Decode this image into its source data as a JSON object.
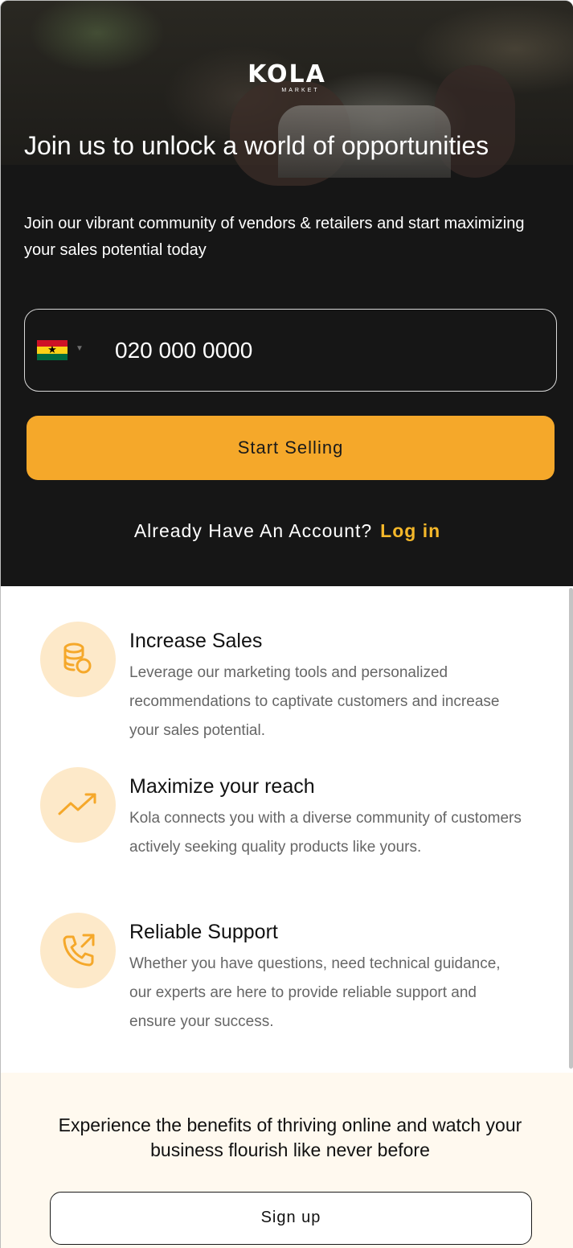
{
  "brand": {
    "logo_word": "KOLA",
    "logo_sub": "MARKET"
  },
  "hero": {
    "title": "Join us to unlock a world of opportunities",
    "subtitle": "Join our vibrant community of vendors & retailers and start maximizing your sales potential today",
    "phone": {
      "country": "Ghana",
      "flag_icon": "ghana-flag-icon",
      "value": "020 000 0000"
    },
    "start_button": "Start Selling",
    "login_prompt": "Already Have An Account?",
    "login_link": "Log in"
  },
  "features": [
    {
      "icon": "coins-icon",
      "title": "Increase Sales",
      "description": "Leverage our marketing tools and personalized recommendations to captivate customers and increase your sales potential."
    },
    {
      "icon": "trending-up-icon",
      "title": "Maximize your reach",
      "description": "Kola connects you with a diverse community of customers actively seeking quality products like yours."
    },
    {
      "icon": "phone-outgoing-icon",
      "title": "Reliable Support",
      "description": "Whether you have questions, need technical guidance, our experts are here to provide reliable support and ensure your success."
    }
  ],
  "cta": {
    "text": "Experience the benefits of thriving online and watch your business flourish like never before",
    "signup_button": "Sign up"
  },
  "colors": {
    "accent": "#f5a82a",
    "login_link": "#f5b82a",
    "hero_bg": "#161616",
    "icon_circle": "#fde9c9",
    "cta_bg": "#fff9ef"
  }
}
